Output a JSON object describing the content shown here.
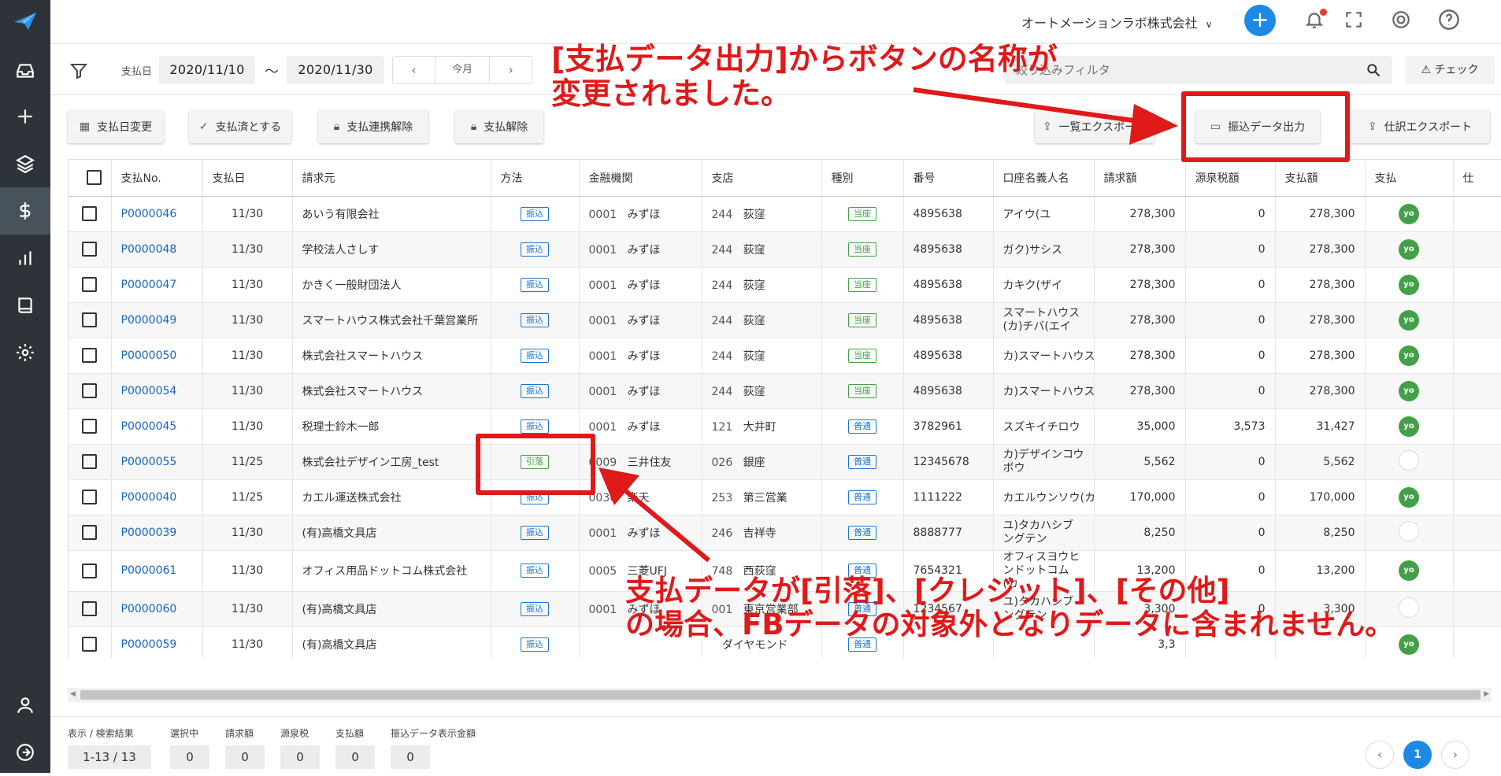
{
  "topbar": {
    "company": "オートメーションラボ株式会社",
    "plus": "+"
  },
  "filter": {
    "date_label": "支払日",
    "date_from": "2020/11/10",
    "tilde": "〜",
    "date_to": "2020/11/30",
    "prev": "‹",
    "current": "今月",
    "next": "›",
    "search_placeholder": "絞り込みフィルタ",
    "check_label": "チェック"
  },
  "actions": {
    "change_date": "支払日変更",
    "mark_paid": "支払済とする",
    "unlink": "支払連携解除",
    "cancel": "支払解除",
    "list_export": "一覧エクスポート",
    "transfer_export": "振込データ出力",
    "journal_export": "仕訳エクスポート"
  },
  "table": {
    "headers": [
      "支払No.",
      "支払日",
      "請求元",
      "方法",
      "金融機関",
      "支店",
      "種別",
      "番号",
      "口座名義人名",
      "請求額",
      "源泉税額",
      "支払額",
      "支払",
      "仕"
    ],
    "rows": [
      {
        "no": "P0000046",
        "date": "11/30",
        "vendor": "あいう有限会社",
        "method": "振込",
        "bank_code": "0001",
        "bank": "みずほ",
        "br_code": "244",
        "branch": "荻窪",
        "type": "当座",
        "num": "4895638",
        "holder": "アイウ(ユ",
        "amount": "278,300",
        "tax": "0",
        "paid": "278,300",
        "status": "yo"
      },
      {
        "no": "P0000048",
        "date": "11/30",
        "vendor": "学校法人さしす",
        "method": "振込",
        "bank_code": "0001",
        "bank": "みずほ",
        "br_code": "244",
        "branch": "荻窪",
        "type": "当座",
        "num": "4895638",
        "holder": "ガク)サシス",
        "amount": "278,300",
        "tax": "0",
        "paid": "278,300",
        "status": "yo"
      },
      {
        "no": "P0000047",
        "date": "11/30",
        "vendor": "かきく一般財団法人",
        "method": "振込",
        "bank_code": "0001",
        "bank": "みずほ",
        "br_code": "244",
        "branch": "荻窪",
        "type": "当座",
        "num": "4895638",
        "holder": "カキク(ザイ",
        "amount": "278,300",
        "tax": "0",
        "paid": "278,300",
        "status": "yo"
      },
      {
        "no": "P0000049",
        "date": "11/30",
        "vendor": "スマートハウス株式会社千葉営業所",
        "method": "振込",
        "bank_code": "0001",
        "bank": "みずほ",
        "br_code": "244",
        "branch": "荻窪",
        "type": "当座",
        "num": "4895638",
        "holder": "スマートハウス(カ)チバ(エイ",
        "amount": "278,300",
        "tax": "0",
        "paid": "278,300",
        "status": "yo"
      },
      {
        "no": "P0000050",
        "date": "11/30",
        "vendor": "株式会社スマートハウス",
        "method": "振込",
        "bank_code": "0001",
        "bank": "みずほ",
        "br_code": "244",
        "branch": "荻窪",
        "type": "当座",
        "num": "4895638",
        "holder": "カ)スマートハウス",
        "amount": "278,300",
        "tax": "0",
        "paid": "278,300",
        "status": "yo"
      },
      {
        "no": "P0000054",
        "date": "11/30",
        "vendor": "株式会社スマートハウス",
        "method": "振込",
        "bank_code": "0001",
        "bank": "みずほ",
        "br_code": "244",
        "branch": "荻窪",
        "type": "当座",
        "num": "4895638",
        "holder": "カ)スマートハウス",
        "amount": "278,300",
        "tax": "0",
        "paid": "278,300",
        "status": "yo"
      },
      {
        "no": "P0000045",
        "date": "11/30",
        "vendor": "税理士鈴木一郎",
        "method": "振込",
        "bank_code": "0001",
        "bank": "みずほ",
        "br_code": "121",
        "branch": "大井町",
        "type": "普通",
        "num": "3782961",
        "holder": "スズキイチロウ",
        "amount": "35,000",
        "tax": "3,573",
        "paid": "31,427",
        "status": "yo"
      },
      {
        "no": "P0000055",
        "date": "11/25",
        "vendor": "株式会社デザイン工房_test",
        "method": "引落",
        "bank_code": "0009",
        "bank": "三井住友",
        "br_code": "026",
        "branch": "銀座",
        "type": "普通",
        "num": "12345678",
        "holder": "カ)デザインコウボウ",
        "amount": "5,562",
        "tax": "0",
        "paid": "5,562",
        "status": ""
      },
      {
        "no": "P0000040",
        "date": "11/25",
        "vendor": "カエル運送株式会社",
        "method": "振込",
        "bank_code": "0036",
        "bank": "楽天",
        "br_code": "253",
        "branch": "第三営業",
        "type": "普通",
        "num": "1111222",
        "holder": "カエルウンソウ(カ",
        "amount": "170,000",
        "tax": "0",
        "paid": "170,000",
        "status": "yo"
      },
      {
        "no": "P0000039",
        "date": "11/30",
        "vendor": "(有)高橋文具店",
        "method": "振込",
        "bank_code": "0001",
        "bank": "みずほ",
        "br_code": "246",
        "branch": "吉祥寺",
        "type": "普通",
        "num": "8888777",
        "holder": "ユ)タカハシブングテン",
        "amount": "8,250",
        "tax": "0",
        "paid": "8,250",
        "status": ""
      },
      {
        "no": "P0000061",
        "date": "11/30",
        "vendor": "オフィス用品ドットコム株式会社",
        "method": "振込",
        "bank_code": "0005",
        "bank": "三菱UFJ",
        "br_code": "748",
        "branch": "西荻窪",
        "type": "普通",
        "num": "7654321",
        "holder": "オフィスヨウヒンドットコム(カ",
        "amount": "13,200",
        "tax": "0",
        "paid": "13,200",
        "status": "yo"
      },
      {
        "no": "P0000060",
        "date": "11/30",
        "vendor": "(有)高橋文具店",
        "method": "振込",
        "bank_code": "0001",
        "bank": "みずほ",
        "br_code": "001",
        "branch": "東京営業部",
        "type": "普通",
        "num": "1234567",
        "holder": "ユ)タカハシブングテン",
        "amount": "3,300",
        "tax": "0",
        "paid": "3,300",
        "status": ""
      },
      {
        "no": "P0000059",
        "date": "11/30",
        "vendor": "(有)高橋文具店",
        "method": "振込",
        "bank_code": "",
        "bank": "",
        "br_code": "",
        "branch": "ダイヤモンド",
        "type": "普通",
        "num": "",
        "holder": "",
        "amount": "3,3",
        "tax": "",
        "paid": "",
        "status": "yo"
      }
    ]
  },
  "footer": {
    "labels": [
      "表示 / 検索結果",
      "選択中",
      "請求額",
      "源泉税",
      "支払額",
      "振込データ表示金額"
    ],
    "values": [
      "1-13 / 13",
      "0",
      "0",
      "0",
      "0",
      "0"
    ],
    "page": "1",
    "prev": "‹",
    "next": "›"
  },
  "annotations": {
    "top_line1": "[支払データ出力]からボタンの名称が",
    "top_line2": "変更されました。",
    "bottom_line1": "支払データが[引落]、[クレジット]、[その他]",
    "bottom_line2": "の場合、FBデータの対象外となりデータに含まれません。"
  },
  "colors": {
    "accent": "#1e88e5",
    "sidebar": "#2d3339",
    "annotation": "#e01919",
    "paid_badge": "#43a047"
  }
}
